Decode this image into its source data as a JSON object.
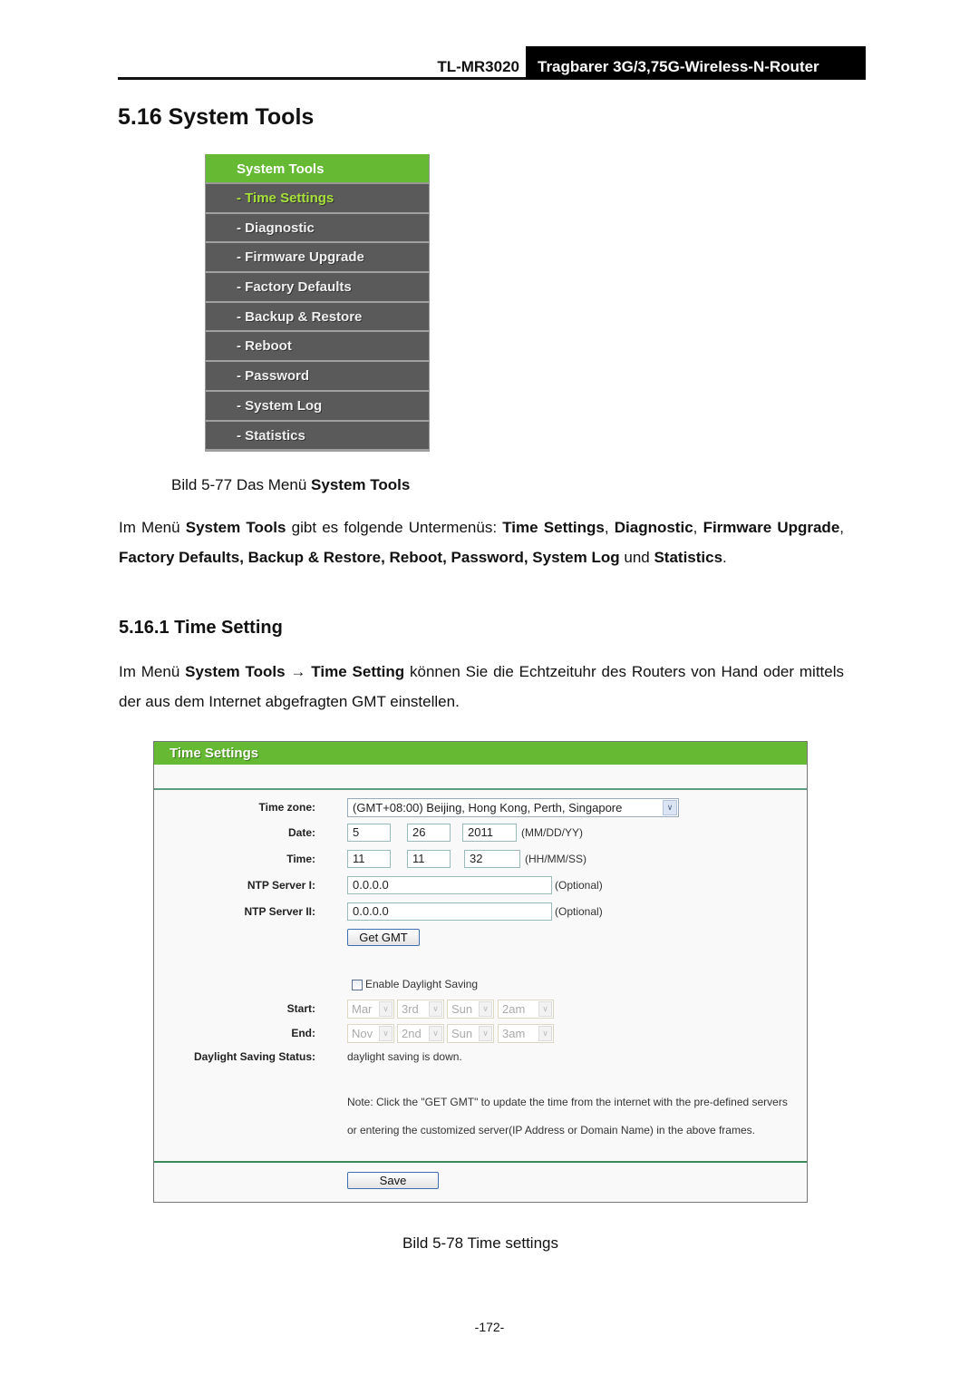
{
  "header": {
    "model": "TL-MR3020",
    "product": "Tragbarer 3G/3,75G-Wireless-N-Router"
  },
  "section": {
    "title": "5.16  System Tools"
  },
  "menu": {
    "title": "System Tools",
    "items": [
      {
        "label": "- Time Settings",
        "active": true
      },
      {
        "label": "- Diagnostic"
      },
      {
        "label": "- Firmware Upgrade"
      },
      {
        "label": "- Factory Defaults"
      },
      {
        "label": "- Backup & Restore"
      },
      {
        "label": "- Reboot"
      },
      {
        "label": "- Password"
      },
      {
        "label": "- System Log"
      },
      {
        "label": "- Statistics"
      }
    ]
  },
  "caption1": {
    "prefix": "Bild 5-77 Das Menü ",
    "bold": "System Tools"
  },
  "para1": {
    "t1": "Im Menü ",
    "b1": "System Tools",
    "t2": " gibt es folgende Untermenüs: ",
    "b2": "Time Settings",
    "t3": ", ",
    "b3": "Diagnostic",
    "t4": ", ",
    "b4": "Firmware Upgrade",
    "t5": ", ",
    "b5": "Factory Defaults, Backup & Restore, Reboot, Password, System Log",
    "t6": " und ",
    "b6": "Statistics",
    "t7": "."
  },
  "subsection": {
    "title": "5.16.1  Time Setting"
  },
  "para2": {
    "t1": "Im Menü ",
    "b1": "System Tools → Time Setting",
    "t2": " können Sie die Echtzeituhr des Routers von Hand oder mittels der aus dem Internet abgefragten GMT einstellen."
  },
  "time_settings": {
    "title": "Time Settings",
    "timezone_label": "Time zone:",
    "timezone_value": "(GMT+08:00) Beijing, Hong Kong, Perth, Singapore",
    "date_label": "Date:",
    "date_month": "5",
    "date_day": "26",
    "date_year": "2011",
    "date_hint": "(MM/DD/YY)",
    "time_label": "Time:",
    "time_hour": "11",
    "time_minute": "11",
    "time_second": "32",
    "time_hint": "(HH/MM/SS)",
    "ntp1_label": "NTP Server I:",
    "ntp1_value": "0.0.0.0",
    "ntp1_hint": "(Optional)",
    "ntp2_label": "NTP Server II:",
    "ntp2_value": "0.0.0.0",
    "ntp2_hint": "(Optional)",
    "get_gmt_label": "Get GMT",
    "dst_checkbox_label": "Enable Daylight Saving",
    "dst_enabled": false,
    "start_label": "Start:",
    "start": [
      "Mar",
      "3rd",
      "Sun",
      "2am"
    ],
    "end_label": "End:",
    "end": [
      "Nov",
      "2nd",
      "Sun",
      "3am"
    ],
    "dst_status_label": "Daylight Saving Status:",
    "dst_status_value": "daylight saving is down.",
    "note_line1": "Note: Click the \"GET GMT\" to update the time from the internet with the pre-defined servers",
    "note_line2": "or entering the customized server(IP Address or Domain Name) in the above frames.",
    "save_label": "Save"
  },
  "caption2": "Bild 5-78 Time settings",
  "page_number": "-172-",
  "colors": {
    "menu_header_green": "#66b933",
    "menu_item_bg": "#5a5a5a",
    "menu_active_text": "#a8e23a"
  }
}
